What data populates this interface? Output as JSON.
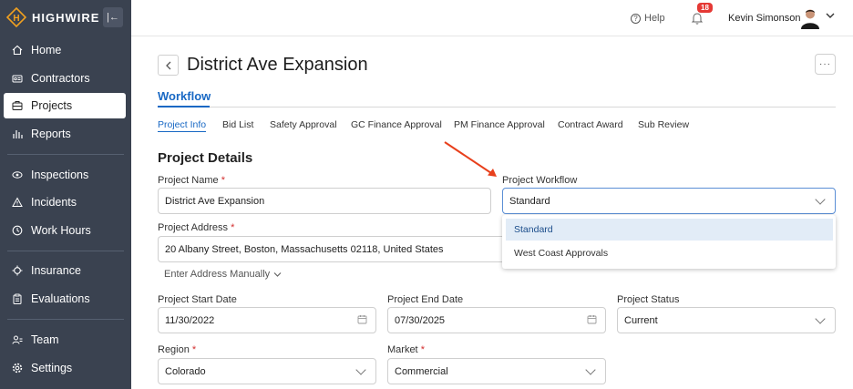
{
  "brand": {
    "name": "HIGHWIRE",
    "logo_letter": "H",
    "accent": "#f0a020"
  },
  "sidebar": {
    "collapse_icon": "collapse-left-icon",
    "items": [
      {
        "label": "Home",
        "icon": "home-icon"
      },
      {
        "label": "Contractors",
        "icon": "contractors-icon"
      },
      {
        "label": "Projects",
        "icon": "projects-icon",
        "active": true
      },
      {
        "label": "Reports",
        "icon": "reports-icon"
      },
      {
        "label": "Inspections",
        "icon": "inspections-icon"
      },
      {
        "label": "Incidents",
        "icon": "warning-icon"
      },
      {
        "label": "Work Hours",
        "icon": "clock-icon"
      },
      {
        "label": "Insurance",
        "icon": "insurance-icon"
      },
      {
        "label": "Evaluations",
        "icon": "evaluations-icon"
      },
      {
        "label": "Team",
        "icon": "team-icon"
      },
      {
        "label": "Settings",
        "icon": "gear-icon"
      }
    ]
  },
  "header": {
    "help_label": "Help",
    "notification_count": "18",
    "user_name": "Kevin Simonson"
  },
  "page": {
    "title": "District Ave Expansion",
    "workflow_tab": "Workflow",
    "subtabs": [
      "Project Info",
      "Bid List",
      "Safety Approval",
      "GC Finance Approval",
      "PM Finance Approval",
      "Contract Award",
      "Sub Review"
    ],
    "section_title": "Project Details"
  },
  "form": {
    "project_name_label": "Project Name",
    "project_name_value": "District Ave Expansion",
    "project_workflow_label": "Project Workflow",
    "project_workflow_value": "Standard",
    "workflow_options": [
      "Standard",
      "West Coast Approvals"
    ],
    "project_address_label": "Project Address",
    "project_address_value": "20 Albany Street, Boston, Massachusetts 02118, United States",
    "enter_address_manually": "Enter Address Manually",
    "start_date_label": "Project Start Date",
    "start_date_value": "11/30/2022",
    "end_date_label": "Project End Date",
    "end_date_value": "07/30/2025",
    "status_label": "Project Status",
    "status_value": "Current",
    "region_label": "Region",
    "region_value": "Colorado",
    "market_label": "Market",
    "market_value": "Commercial",
    "required_marker": "*"
  },
  "colors": {
    "sidebar_bg": "#3a4250",
    "link_blue": "#1868c4",
    "annotation_arrow": "#e8401c"
  }
}
